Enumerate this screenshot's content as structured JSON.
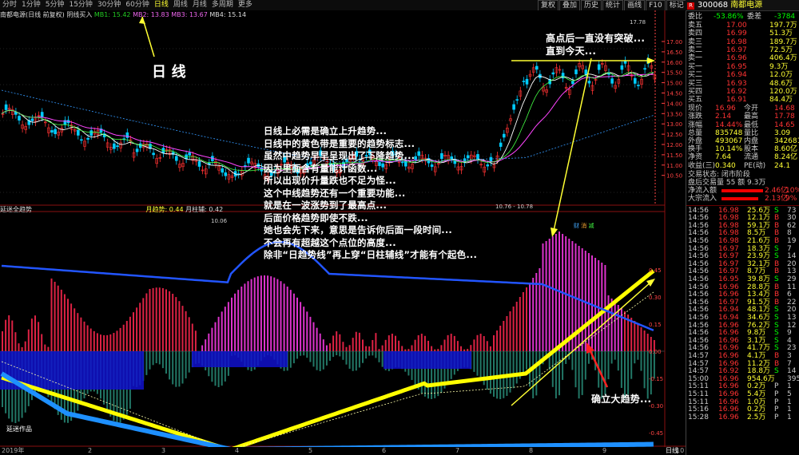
{
  "toolbar": {
    "timeframes": [
      "分时",
      "1分钟",
      "5分钟",
      "15分钟",
      "30分钟",
      "60分钟",
      "日线",
      "周线",
      "月线",
      "多周期",
      "更多"
    ],
    "active_timeframe": "日线",
    "right_buttons": [
      "复权",
      "叠加",
      "历史",
      "统计",
      "画线",
      "F10",
      "标记",
      "+自选",
      "返回"
    ]
  },
  "stock": {
    "code": "300068",
    "name": "南都电源"
  },
  "legend_main": {
    "prefix": "南都电源(日线 前复权)",
    "indicator": "阴线买入",
    "mb1": "MB1: 15.42",
    "mb2": "MB2: 13.83",
    "mb3": "MB3: 13.67",
    "mb4": "MB4: 15.14"
  },
  "legend_sub": {
    "prefix": "延迷全趋势",
    "month": "月趋势: 0.44",
    "month_bar": "月柱辅: 0.42"
  },
  "annotations": {
    "daily_line": "日 线",
    "top_note": [
      "高点后一直没有突破...",
      "直到今天..."
    ],
    "main_note": [
      "日线上必需是确立上升趋势...",
      "日线中的黄色带是重要的趋势标志...",
      "虽然中趋势早早呈现出了下降趋势...",
      "因为里面含有量能计函数...",
      "所以出现价升量跌也不足为怪...",
      "这个中线趋势还有一个重要功能...",
      "就是在一波涨势到了最高点...",
      "后面价格趋势即使不跌...",
      "她也会先下来，意思是告诉你后面一段时间...",
      "不会再有超越这个点位的高度...",
      "除非“日趋势线”再上穿“日柱辅线”才能有个起色..."
    ],
    "uptrend": "确立大趋势...",
    "signature": "延迷作品",
    "peak_price": "17.78",
    "low_price": "10.06",
    "range_label": "10.76 - 10.78"
  },
  "price_axis": [
    "17.00",
    "16.50",
    "16.00",
    "15.50",
    "15.00",
    "14.50",
    "14.00",
    "13.50",
    "13.00",
    "12.50",
    "12.00",
    "11.50",
    "11.00",
    "10.50"
  ],
  "sub_axis": [
    "0.45",
    "0.30",
    "0.15",
    "0.00",
    "-0.15",
    "-0.30",
    "-0.45"
  ],
  "x_axis": {
    "year": "2019年",
    "months": [
      "2",
      "3",
      "4",
      "5",
      "6",
      "7",
      "8",
      "9",
      "10"
    ],
    "period": "日线"
  },
  "quote": {
    "weibi_label": "委比",
    "weibi": "-53.86%",
    "weicha_label": "委差",
    "weicha": "-3784",
    "asks": [
      {
        "label": "卖五",
        "price": "17.00",
        "vol": "197.7万"
      },
      {
        "label": "卖四",
        "price": "16.99",
        "vol": "51.3万"
      },
      {
        "label": "卖三",
        "price": "16.98",
        "vol": "189.7万"
      },
      {
        "label": "卖二",
        "price": "16.97",
        "vol": "72.5万"
      },
      {
        "label": "卖一",
        "price": "16.96",
        "vol": "406.4万"
      }
    ],
    "bids": [
      {
        "label": "买一",
        "price": "16.95",
        "vol": "9.3万"
      },
      {
        "label": "买二",
        "price": "16.94",
        "vol": "12.0万"
      },
      {
        "label": "买三",
        "price": "16.93",
        "vol": "48.6万"
      },
      {
        "label": "买四",
        "price": "16.92",
        "vol": "120.0万"
      },
      {
        "label": "买五",
        "price": "16.91",
        "vol": "84.4万"
      }
    ],
    "stats": [
      {
        "l1": "现价",
        "v1": "16.96",
        "l2": "今开",
        "v2": "14.68"
      },
      {
        "l1": "涨跌",
        "v1": "2.14",
        "l2": "最高",
        "v2": "17.78"
      },
      {
        "l1": "涨幅",
        "v1": "14.44%",
        "l2": "最低",
        "v2": "14.65"
      },
      {
        "l1": "总量",
        "v1": "835748",
        "l2": "量比",
        "v2": "3.09"
      },
      {
        "l1": "外盘",
        "v1": "493067",
        "l2": "内盘",
        "v2": "342681"
      },
      {
        "l1": "换手",
        "v1": "10.14%",
        "l2": "股本",
        "v2": "8.60亿"
      },
      {
        "l1": "净资",
        "v1": "7.64",
        "l2": "流通",
        "v2": "8.24亿"
      },
      {
        "l1": "收益(三)",
        "v1": "0.340",
        "l2": "PE(动)",
        "v2": "24.1"
      }
    ],
    "status": "交易状态: 闭市阶段",
    "lot_info": "盘后交易量 55 额 9.3万",
    "net_flow_in": {
      "label": "净流入额",
      "value": "2.46亿",
      "pct": "10%"
    },
    "big_flow_in": {
      "label": "大宗流入",
      "value": "2.13亿",
      "pct": "9%"
    }
  },
  "trades": [
    {
      "t": "14:56",
      "p": "16.98",
      "v": "25.6万",
      "d": "S",
      "n": "73"
    },
    {
      "t": "14:56",
      "p": "16.98",
      "v": "12.1万",
      "d": "B",
      "n": "30"
    },
    {
      "t": "14:56",
      "p": "16.98",
      "v": "59.1万",
      "d": "B",
      "n": "62"
    },
    {
      "t": "14:56",
      "p": "16.98",
      "v": "8.5万",
      "d": "B",
      "n": "8"
    },
    {
      "t": "14:56",
      "p": "16.98",
      "v": "21.6万",
      "d": "B",
      "n": "19"
    },
    {
      "t": "14:56",
      "p": "16.97",
      "v": "18.3万",
      "d": "S",
      "n": "7"
    },
    {
      "t": "14:56",
      "p": "16.97",
      "v": "23.9万",
      "d": "S",
      "n": "14"
    },
    {
      "t": "14:56",
      "p": "16.97",
      "v": "32.1万",
      "d": "B",
      "n": "20"
    },
    {
      "t": "14:56",
      "p": "16.97",
      "v": "8.7万",
      "d": "B",
      "n": "13"
    },
    {
      "t": "14:56",
      "p": "16.95",
      "v": "39.8万",
      "d": "S",
      "n": "29"
    },
    {
      "t": "14:56",
      "p": "16.96",
      "v": "28.8万",
      "d": "B",
      "n": "11"
    },
    {
      "t": "14:56",
      "p": "16.96",
      "v": "13.4万",
      "d": "B",
      "n": "6"
    },
    {
      "t": "14:56",
      "p": "16.97",
      "v": "91.5万",
      "d": "B",
      "n": "22"
    },
    {
      "t": "14:56",
      "p": "16.94",
      "v": "48.1万",
      "d": "S",
      "n": "20"
    },
    {
      "t": "14:56",
      "p": "16.94",
      "v": "34.6万",
      "d": "S",
      "n": "13"
    },
    {
      "t": "14:56",
      "p": "16.96",
      "v": "76.2万",
      "d": "S",
      "n": "12"
    },
    {
      "t": "14:56",
      "p": "16.96",
      "v": "9.8万",
      "d": "S",
      "n": "9"
    },
    {
      "t": "14:56",
      "p": "16.96",
      "v": "3.1万",
      "d": "S",
      "n": "4"
    },
    {
      "t": "14:56",
      "p": "16.96",
      "v": "41.7万",
      "d": "S",
      "n": "23"
    },
    {
      "t": "14:57",
      "p": "16.96",
      "v": "4.1万",
      "d": "B",
      "n": "3"
    },
    {
      "t": "14:57",
      "p": "16.96",
      "v": "11.2万",
      "d": "B",
      "n": "7"
    },
    {
      "t": "14:57",
      "p": "16.92",
      "v": "18.8万",
      "d": "S",
      "n": "14"
    },
    {
      "t": "15:00",
      "p": "16.96",
      "v": "954.6万",
      "d": "",
      "n": "395"
    },
    {
      "t": "15:11",
      "p": "16.96",
      "v": "0.2万",
      "d": "P",
      "n": "1"
    },
    {
      "t": "15:11",
      "p": "16.96",
      "v": "5.4万",
      "d": "P",
      "n": "5"
    },
    {
      "t": "15:11",
      "p": "16.96",
      "v": "1.0万",
      "d": "P",
      "n": "1"
    },
    {
      "t": "15:16",
      "p": "16.96",
      "v": "0.2万",
      "d": "P",
      "n": "1"
    },
    {
      "t": "15:28",
      "p": "16.96",
      "v": "2.5万",
      "d": "P",
      "n": "1"
    }
  ],
  "colors": {
    "up": "#ff3333",
    "down": "#00ccff",
    "accent": "#ffff33",
    "bg": "#000000"
  }
}
